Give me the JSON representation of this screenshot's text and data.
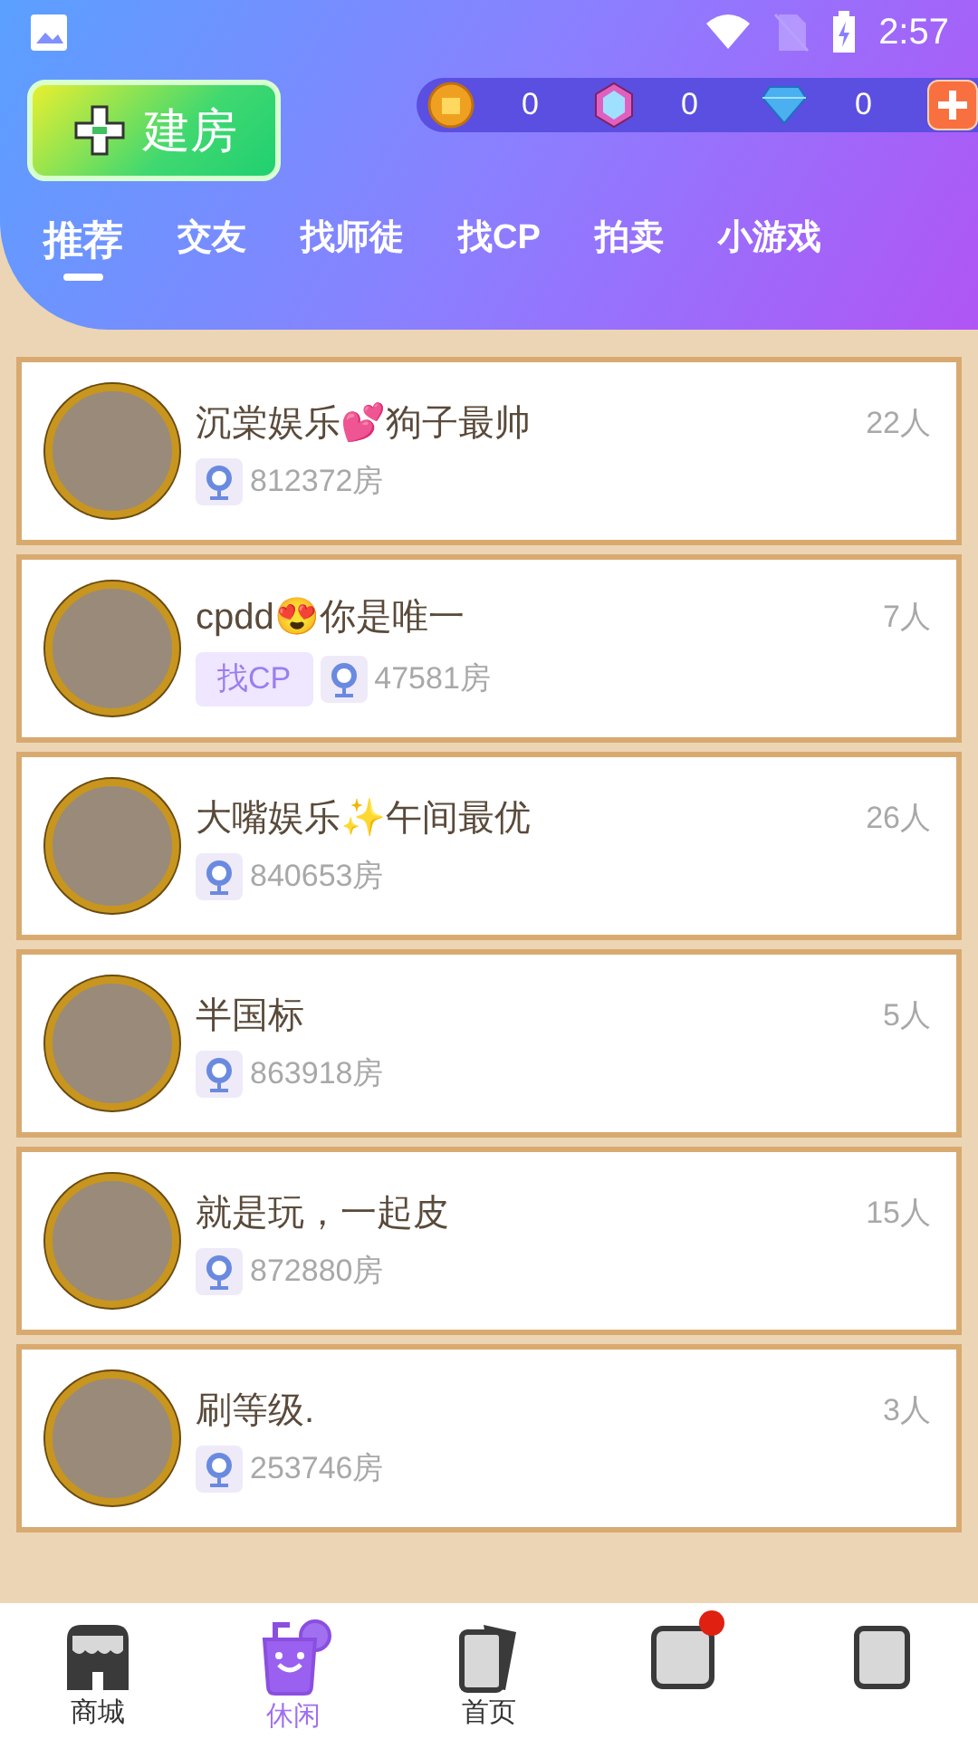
{
  "status_bar": {
    "time": "2:57"
  },
  "create_button": {
    "label": "建房"
  },
  "currencies": [
    {
      "kind": "coin",
      "value": "0"
    },
    {
      "kind": "gem",
      "value": "0"
    },
    {
      "kind": "diamond",
      "value": "0"
    }
  ],
  "tabs": [
    {
      "label": "推荐",
      "selected": true
    },
    {
      "label": "交友",
      "selected": false
    },
    {
      "label": "找师徒",
      "selected": false
    },
    {
      "label": "找CP",
      "selected": false
    },
    {
      "label": "拍卖",
      "selected": false
    },
    {
      "label": "小游戏",
      "selected": false
    }
  ],
  "rooms": [
    {
      "name": "沉棠娱乐💕狗子最帅",
      "room_no": "812372房",
      "count": "22人"
    },
    {
      "name": "cpdd😍你是唯一",
      "tag": "找CP",
      "room_no": "47581房",
      "count": "7人"
    },
    {
      "name": "大嘴娱乐✨午间最优",
      "room_no": "840653房",
      "count": "26人"
    },
    {
      "name": "半国标",
      "room_no": "863918房",
      "count": "5人"
    },
    {
      "name": "就是玩，一起皮",
      "room_no": "872880房",
      "count": "15人"
    },
    {
      "name": "刷等级.",
      "room_no": "253746房",
      "count": "3人"
    }
  ],
  "nav": [
    {
      "kind": "shop",
      "label": "商城",
      "selected": false
    },
    {
      "kind": "drink",
      "label": "休闲",
      "selected": true
    },
    {
      "kind": "cards",
      "label": "首页",
      "selected": false
    },
    {
      "kind": "message",
      "selected": false,
      "badge": true
    },
    {
      "kind": "profile",
      "selected": false
    }
  ]
}
